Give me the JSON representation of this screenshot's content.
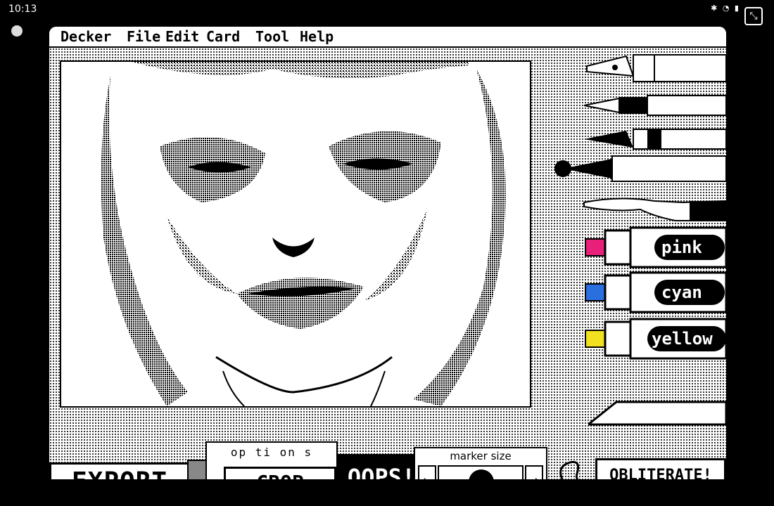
{
  "status_bar": {
    "time": "10:13",
    "icons": "✱ ◔ ▮",
    "fullscreen_icon": "fullscreen-exit-icon"
  },
  "menu": {
    "items": [
      "Decker",
      "File",
      "Edit",
      "Card",
      "Tool",
      "Help"
    ]
  },
  "tools": {
    "pens": [
      "fountain-pen-icon",
      "technical-pen-icon",
      "brush-pen-icon",
      "paint-brush-icon",
      "smudge-finger-icon"
    ],
    "markers": [
      {
        "label": "pink",
        "color": "#e8207a"
      },
      {
        "label": "cyan",
        "color": "#2a6fe0"
      },
      {
        "label": "yellow",
        "color": "#f0e020"
      }
    ],
    "eraser_icon": "eraser-icon"
  },
  "bottom": {
    "export_label": "EXPORT",
    "options_label": "op ti on s",
    "crop_label": "CROP",
    "oops_label": "OOPS!",
    "marker_size_label": "marker size",
    "left_arrow": "⇦",
    "right_arrow": "⇨",
    "obliterate_label": "OBLITERATE!"
  }
}
